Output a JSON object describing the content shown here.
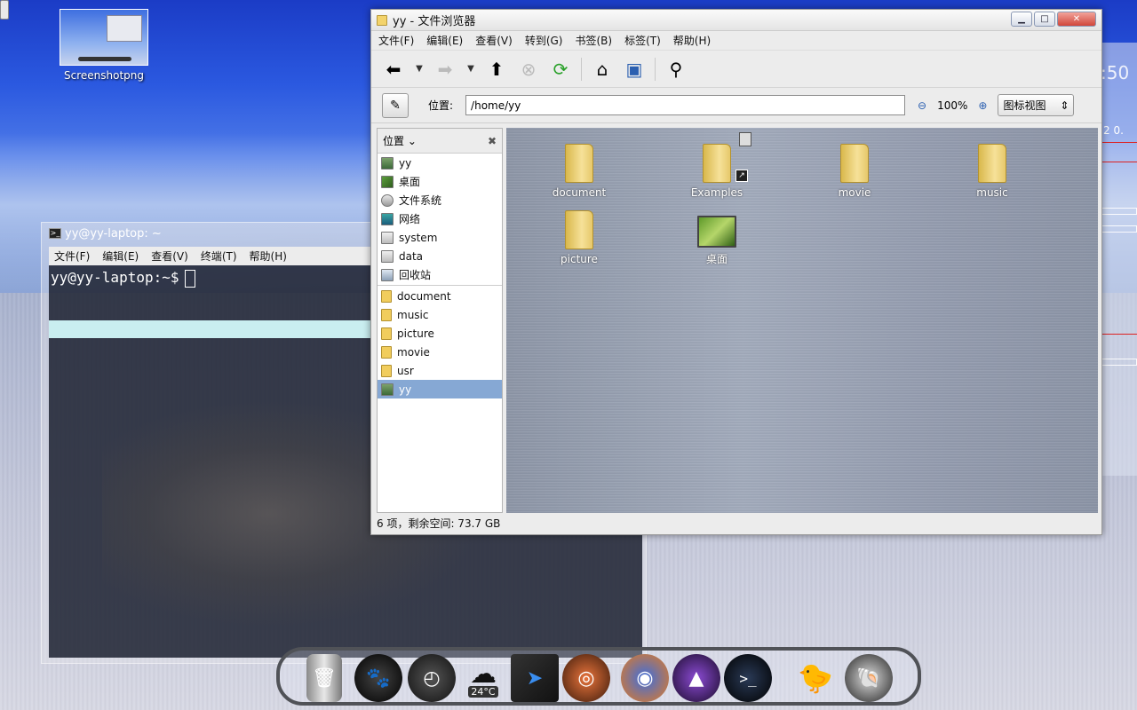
{
  "desktop": {
    "icon_label": "Screenshotpng"
  },
  "background_widget": {
    "clock": ":50",
    "date": "2 0."
  },
  "terminal": {
    "title": "yy@yy-laptop: ~",
    "menu": [
      "文件(F)",
      "编辑(E)",
      "查看(V)",
      "终端(T)",
      "帮助(H)"
    ],
    "prompt": "yy@yy-laptop:~$"
  },
  "file_browser": {
    "title": "yy - 文件浏览器",
    "menu": [
      "文件(F)",
      "编辑(E)",
      "查看(V)",
      "转到(G)",
      "书签(B)",
      "标签(T)",
      "帮助(H)"
    ],
    "location_label": "位置:",
    "location_value": "/home/yy",
    "zoom_level": "100%",
    "view_mode": "图标视图",
    "sidebar": {
      "header": "位置",
      "places": [
        "yy",
        "桌面",
        "文件系统",
        "网络",
        "system",
        "data",
        "回收站"
      ],
      "bookmarks": [
        "document",
        "music",
        "picture",
        "movie",
        "usr",
        "yy"
      ],
      "selected": "yy"
    },
    "files": [
      {
        "name": "document",
        "type": "folder"
      },
      {
        "name": "Examples",
        "type": "folder-link"
      },
      {
        "name": "movie",
        "type": "folder"
      },
      {
        "name": "music",
        "type": "folder"
      },
      {
        "name": "picture",
        "type": "folder"
      },
      {
        "name": "桌面",
        "type": "image"
      }
    ],
    "status": "6 项，剩余空间: 73.7 GB"
  },
  "dock": {
    "weather_temp": "24°C",
    "items": [
      "trash-icon",
      "gnome-icon",
      "clock-icon",
      "weather-icon",
      "cursor-icon",
      "ubuntu-icon",
      "firefox-icon",
      "inkscape-icon",
      "terminal-icon",
      "bird-icon",
      "shell-icon"
    ]
  }
}
